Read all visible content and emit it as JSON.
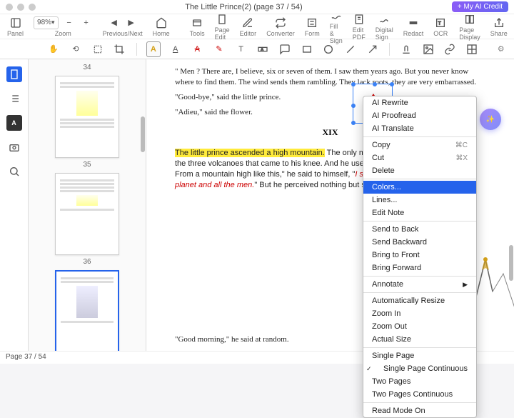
{
  "title": "The Little Prince(2) (page 37 / 54)",
  "ai_credit": "+ My AI Credit",
  "toolbar": {
    "panel": "Panel",
    "zoom_val": "98%",
    "zoom": "Zoom",
    "prevnext": "Previous/Next",
    "home": "Home",
    "tools": "Tools",
    "pageedit": "Page Edit",
    "editor": "Editor",
    "converter": "Converter",
    "form": "Form",
    "fillsign": "Fill & Sign",
    "editpdf": "Edit PDF",
    "digitalsign": "Digital Sign",
    "redact": "Redact",
    "ocr": "OCR",
    "pagedisplay": "Page Display",
    "share": "Share"
  },
  "thumbs": [
    {
      "n": "34"
    },
    {
      "n": "35"
    },
    {
      "n": "36"
    }
  ],
  "doc": {
    "p1": "\" Men ? There are, I believe, six or seven of them. I saw them years ago. But you never know where to find them. The wind sends them rambling. They lack roots, they are very embarrassed.",
    "p2": "\"Good-bye,\" said the little prince.",
    "p3": "\"Adieu,\" said the flower.",
    "chapter": "XIX",
    "p4a": "The little prince ascended a high mountain.",
    "p4b": " The only mou",
    "p4c": "the three volcanoes that came to his knee. And he used the",
    "p4d": "From a mountain high like this,\" he said to himself, \"",
    "p4e": "I sha",
    "p4f": "planet and all the men.",
    "p4g": "\" But he perceived nothing but shar",
    "p5": "\"Good morning,\" he said at random."
  },
  "ctx": {
    "ai_rewrite": "AI Rewrite",
    "ai_proof": "AI Proofread",
    "ai_trans": "AI Translate",
    "copy": "Copy",
    "copy_sc": "⌘C",
    "cut": "Cut",
    "cut_sc": "⌘X",
    "delete": "Delete",
    "colors": "Colors...",
    "lines": "Lines...",
    "editnote": "Edit Note",
    "sendback": "Send to Back",
    "sendbackward": "Send Backward",
    "bringfront": "Bring to Front",
    "bringforward": "Bring Forward",
    "annotate": "Annotate",
    "autoresize": "Automatically Resize",
    "zoomin": "Zoom In",
    "zoomout": "Zoom Out",
    "actualsize": "Actual Size",
    "singlepage": "Single Page",
    "singlecont": "Single Page Continuous",
    "twopages": "Two Pages",
    "twocont": "Two Pages Continuous",
    "readmode": "Read Mode On"
  },
  "status": "Page 37 / 54"
}
